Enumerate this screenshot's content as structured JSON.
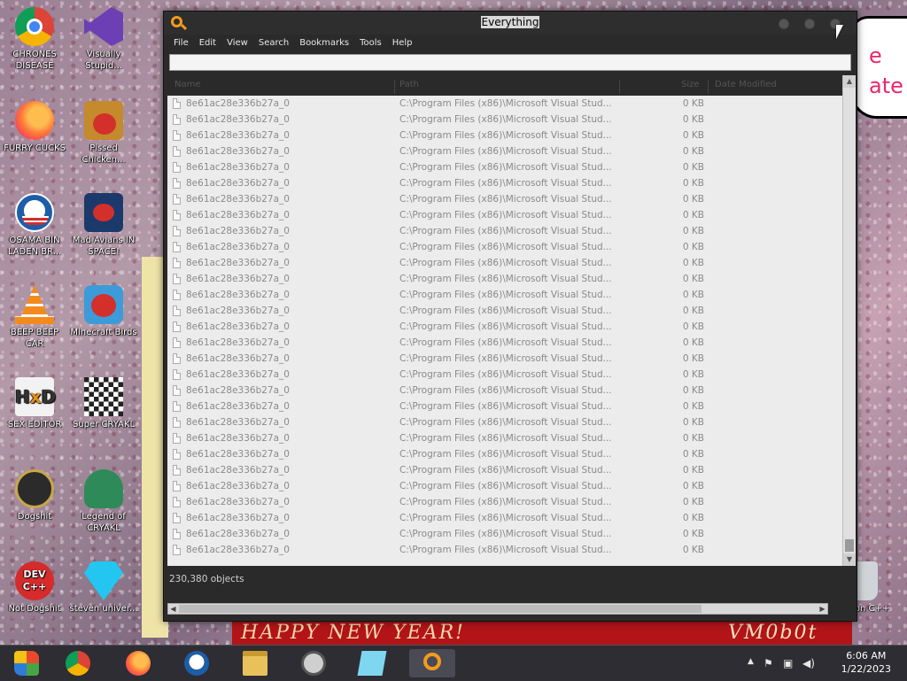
{
  "desktop": {
    "icons": [
      {
        "label": "CHRONES DISEASE",
        "icon": "chrome-icon"
      },
      {
        "label": "Visually Stupid...",
        "icon": "visual-studio-icon"
      },
      {
        "label": "FURRY CUCKS",
        "icon": "firefox-icon"
      },
      {
        "label": "Pissed Chicken...",
        "icon": "angry-birds-seasons-icon"
      },
      {
        "label": "OSAMA BIN LADEN BR...",
        "icon": "obama-logo-icon"
      },
      {
        "label": "Mad Avians IN SPACE!",
        "icon": "angry-birds-space-icon"
      },
      {
        "label": "BEEP BEEP CAR",
        "icon": "vlc-icon"
      },
      {
        "label": "Minecraft Birds",
        "icon": "angry-birds-icon"
      },
      {
        "label": "SEX EDITOR",
        "icon": "hxd-icon"
      },
      {
        "label": "Super CRYAKL",
        "icon": "pixel-art-icon"
      },
      {
        "label": "Dogshit",
        "icon": "codeblocks-icon"
      },
      {
        "label": "Legend of CRYAKL",
        "icon": "legend-icon"
      },
      {
        "label": "Not Dogshit",
        "icon": "devcpp-icon"
      },
      {
        "label": "steven univer...",
        "icon": "gem-icon"
      },
      {
        "label": "Falcon C++",
        "icon": "recycle-bin-icon"
      }
    ],
    "banner_left": "HAPPY NEW YEAR!",
    "banner_right": "VM0b0t",
    "sign_text_1": "e",
    "sign_text_2": "ate",
    "partial_labels": [
      "st u",
      "Da",
      "F",
      "C",
      "s u",
      "Lo"
    ]
  },
  "window": {
    "title": "Everything",
    "menu": [
      "File",
      "Edit",
      "View",
      "Search",
      "Bookmarks",
      "Tools",
      "Help"
    ],
    "search": {
      "value": "",
      "placeholder": ""
    },
    "columns": [
      "Name",
      "Path",
      "Size",
      "Date Modified"
    ],
    "row_template": {
      "name": "8e61ac28e336b27a_0",
      "path": "C:\\Program Files (x86)\\Microsoft Visual Stud...",
      "size": "0 KB"
    },
    "row_count": 29,
    "status": "230,380 objects"
  },
  "taskbar": {
    "buttons": [
      "start-icon",
      "chrome-icon",
      "firefox-icon",
      "obama-logo-icon",
      "file-explorer-icon",
      "skull-icon",
      "notepad-icon",
      "everything-search-icon"
    ],
    "time": "6:06 AM",
    "date": "1/22/2023"
  },
  "colors": {
    "accent": "#f39b1c",
    "window_bg": "#2a2a2a",
    "list_bg": "#ececec",
    "taskbar_bg": "#2d2d33"
  }
}
